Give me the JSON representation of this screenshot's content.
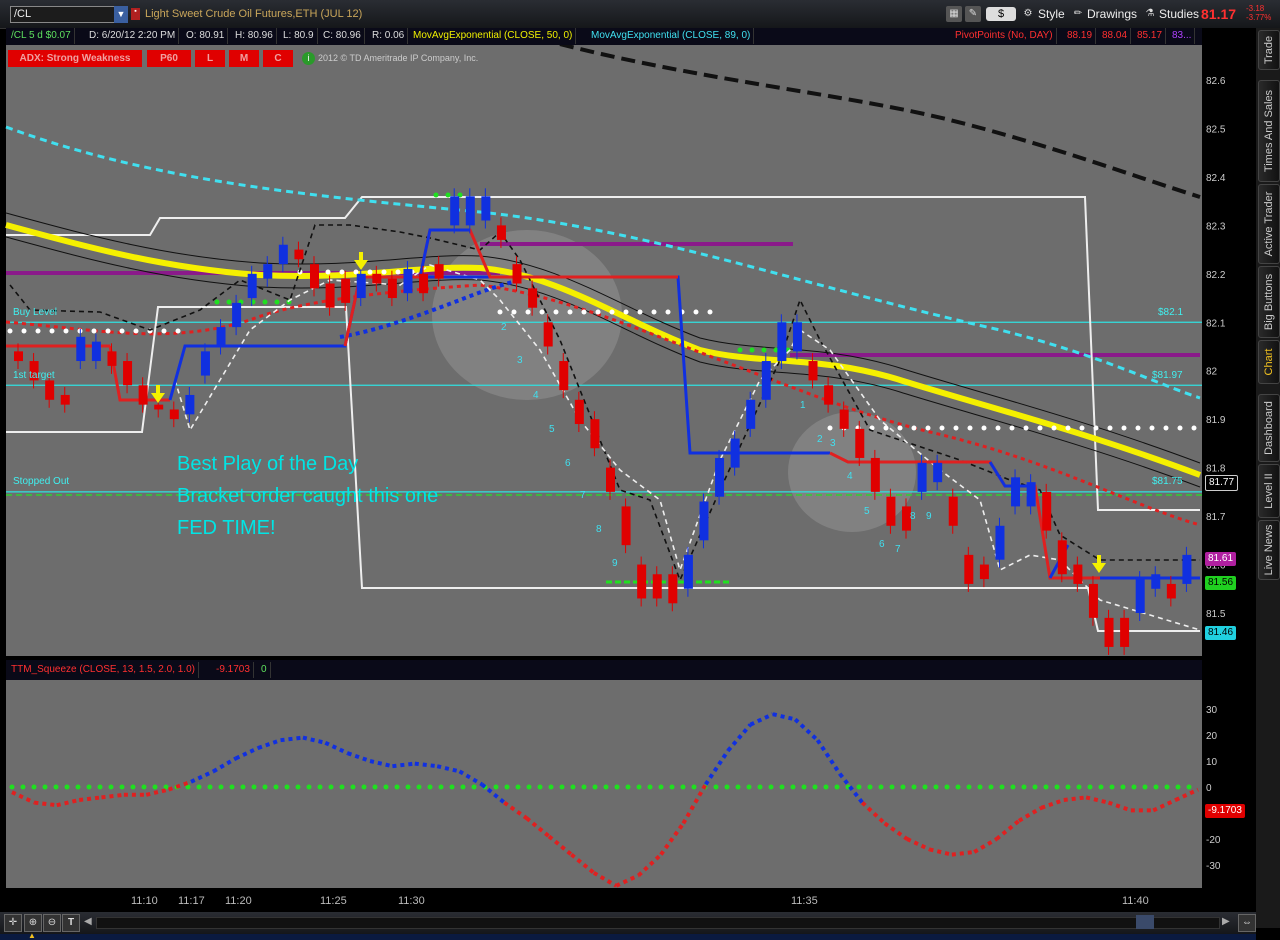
{
  "toolbar": {
    "symbol": "/CL",
    "title": "Light Sweet Crude Oil Futures,ETH (JUL 12)",
    "dollar_label": "$",
    "style_label": "Style",
    "drawings_label": "Drawings",
    "studies_label": "Studies",
    "last_price": "81.17",
    "net_change": "-3.18",
    "net_change_pct": "-3.77%"
  },
  "info_bar": {
    "symbol_cell": "/CL 5 d $0.07",
    "datetime": "D: 6/20/12 2:20 PM",
    "open": "O: 80.91",
    "high": "H: 80.96",
    "low": "L: 80.9",
    "close": "C: 80.96",
    "range": "R: 0.06",
    "ema50": "MovAvgExponential (CLOSE, 50, 0)",
    "ema89": "MovAvgExponential (CLOSE, 89, 0)",
    "pivots": "PivotPoints (No, DAY)",
    "pivot_values": [
      "88.19",
      "88.04",
      "85.17",
      "83..."
    ]
  },
  "adx": {
    "label": "ADX: Strong Weakness",
    "p60": "P60",
    "l": "L",
    "m": "M",
    "c": "C",
    "copyright": "2012 © TD Ameritrade IP Company, Inc."
  },
  "side_tabs": [
    "Trade",
    "Times And Sales",
    "Active Trader",
    "Big Buttons",
    "Chart",
    "Dashboard",
    "Level II",
    "Live News"
  ],
  "annotations": {
    "buy_level": "Buy Level",
    "first_target": "1st target",
    "stopped_out": "Stopped Out",
    "buy_price": "$82.1",
    "target_price": "$81.97",
    "stop_price": "$81.75",
    "play_line1": "Best Play of the Day",
    "play_line2": "Bracket order caught this one",
    "play_line3": "FED TIME!"
  },
  "price_tags": {
    "p1": "81.77",
    "p2": "81.61",
    "p3": "81.56",
    "p4": "81.46"
  },
  "lower": {
    "study": "TTM_Squeeze (CLOSE, 13, 1.5, 2.0, 1.0)",
    "value": "-9.1703",
    "zero": "0",
    "tag": "-9.1703"
  },
  "time_axis": [
    "11:10",
    "11:17",
    "11:20",
    "11:25",
    "11:30",
    "11:35",
    "11:40"
  ],
  "chart_data": [
    {
      "type": "candlestick",
      "title": "Light Sweet Crude Oil Futures,ETH (JUL 12)",
      "ylim": [
        81.4,
        82.65
      ],
      "yticks": [
        81.5,
        81.6,
        81.7,
        81.8,
        81.9,
        82,
        82.1,
        82.2,
        82.3,
        82.4,
        82.5,
        82.6
      ],
      "x_ticks": [
        "11:10",
        "11:17",
        "11:20",
        "11:25",
        "11:30",
        "11:35",
        "11:40"
      ],
      "levels": [
        {
          "name": "Buy Level",
          "value": 82.1
        },
        {
          "name": "1st target",
          "value": 81.97
        },
        {
          "name": "Stopped Out",
          "value": 81.75
        }
      ],
      "candles": [
        {
          "o": 82.04,
          "c": 82.02,
          "up": false
        },
        {
          "o": 82.02,
          "c": 81.98,
          "up": false
        },
        {
          "o": 81.98,
          "c": 81.94,
          "up": false
        },
        {
          "o": 81.95,
          "c": 81.93,
          "up": false
        },
        {
          "o": 82.02,
          "c": 82.07,
          "up": true
        },
        {
          "o": 82.02,
          "c": 82.06,
          "up": true
        },
        {
          "o": 82.04,
          "c": 82.01,
          "up": false
        },
        {
          "o": 82.02,
          "c": 81.97,
          "up": false
        },
        {
          "o": 81.97,
          "c": 81.93,
          "up": false
        },
        {
          "o": 81.93,
          "c": 81.92,
          "up": false
        },
        {
          "o": 81.92,
          "c": 81.9,
          "up": false
        },
        {
          "o": 81.91,
          "c": 81.95,
          "up": true
        },
        {
          "o": 81.99,
          "c": 82.04,
          "up": true
        },
        {
          "o": 82.05,
          "c": 82.09,
          "up": true
        },
        {
          "o": 82.09,
          "c": 82.14,
          "up": true
        },
        {
          "o": 82.15,
          "c": 82.2,
          "up": true
        },
        {
          "o": 82.19,
          "c": 82.22,
          "up": true
        },
        {
          "o": 82.22,
          "c": 82.26,
          "up": true
        },
        {
          "o": 82.25,
          "c": 82.23,
          "up": false
        },
        {
          "o": 82.22,
          "c": 82.17,
          "up": false
        },
        {
          "o": 82.18,
          "c": 82.13,
          "up": false
        },
        {
          "o": 82.19,
          "c": 82.14,
          "up": false
        },
        {
          "o": 82.15,
          "c": 82.2,
          "up": true
        },
        {
          "o": 82.2,
          "c": 82.18,
          "up": false
        },
        {
          "o": 82.19,
          "c": 82.15,
          "up": false
        },
        {
          "o": 82.16,
          "c": 82.21,
          "up": true
        },
        {
          "o": 82.2,
          "c": 82.16,
          "up": false
        },
        {
          "o": 82.22,
          "c": 82.19,
          "up": false
        },
        {
          "o": 82.3,
          "c": 82.36,
          "up": true
        },
        {
          "o": 82.3,
          "c": 82.36,
          "up": true
        },
        {
          "o": 82.31,
          "c": 82.36,
          "up": true
        },
        {
          "o": 82.3,
          "c": 82.27,
          "up": false
        },
        {
          "o": 82.22,
          "c": 82.18,
          "up": false
        },
        {
          "o": 82.17,
          "c": 82.13,
          "up": false
        },
        {
          "o": 82.1,
          "c": 82.05,
          "up": false
        },
        {
          "o": 82.02,
          "c": 81.96,
          "up": false
        },
        {
          "o": 81.94,
          "c": 81.89,
          "up": false
        },
        {
          "o": 81.9,
          "c": 81.84,
          "up": false
        },
        {
          "o": 81.8,
          "c": 81.75,
          "up": false
        },
        {
          "o": 81.72,
          "c": 81.64,
          "up": false
        },
        {
          "o": 81.6,
          "c": 81.53,
          "up": false
        },
        {
          "o": 81.58,
          "c": 81.53,
          "up": false
        },
        {
          "o": 81.58,
          "c": 81.52,
          "up": false
        },
        {
          "o": 81.55,
          "c": 81.62,
          "up": true
        },
        {
          "o": 81.65,
          "c": 81.73,
          "up": true
        },
        {
          "o": 81.74,
          "c": 81.82,
          "up": true
        },
        {
          "o": 81.8,
          "c": 81.86,
          "up": true
        },
        {
          "o": 81.88,
          "c": 81.94,
          "up": true
        },
        {
          "o": 81.94,
          "c": 82.02,
          "up": true
        },
        {
          "o": 82.02,
          "c": 82.1,
          "up": true
        },
        {
          "o": 82.04,
          "c": 82.1,
          "up": true
        },
        {
          "o": 82.02,
          "c": 81.98,
          "up": false
        },
        {
          "o": 81.97,
          "c": 81.93,
          "up": false
        },
        {
          "o": 81.92,
          "c": 81.88,
          "up": false
        },
        {
          "o": 81.88,
          "c": 81.82,
          "up": false
        },
        {
          "o": 81.82,
          "c": 81.75,
          "up": false
        },
        {
          "o": 81.74,
          "c": 81.68,
          "up": false
        },
        {
          "o": 81.72,
          "c": 81.67,
          "up": false
        },
        {
          "o": 81.75,
          "c": 81.81,
          "up": true
        },
        {
          "o": 81.77,
          "c": 81.81,
          "up": true
        },
        {
          "o": 81.74,
          "c": 81.68,
          "up": false
        },
        {
          "o": 81.62,
          "c": 81.56,
          "up": false
        },
        {
          "o": 81.6,
          "c": 81.57,
          "up": false
        },
        {
          "o": 81.61,
          "c": 81.68,
          "up": true
        },
        {
          "o": 81.72,
          "c": 81.78,
          "up": true
        },
        {
          "o": 81.72,
          "c": 81.77,
          "up": true
        },
        {
          "o": 81.75,
          "c": 81.67,
          "up": false
        },
        {
          "o": 81.65,
          "c": 81.58,
          "up": false
        },
        {
          "o": 81.6,
          "c": 81.56,
          "up": false
        },
        {
          "o": 81.56,
          "c": 81.49,
          "up": false
        },
        {
          "o": 81.49,
          "c": 81.43,
          "up": false
        },
        {
          "o": 81.49,
          "c": 81.43,
          "up": false
        },
        {
          "o": 81.5,
          "c": 81.57,
          "up": true
        },
        {
          "o": 81.55,
          "c": 81.58,
          "up": true
        },
        {
          "o": 81.53,
          "c": 81.56,
          "up": false
        },
        {
          "o": 81.56,
          "c": 81.62,
          "up": true
        }
      ]
    },
    {
      "type": "line",
      "title": "TTM_Squeeze (CLOSE, 13, 1.5, 2.0, 1.0)",
      "ylim": [
        -35,
        35
      ],
      "yticks": [
        -30,
        -20,
        -10,
        0,
        10,
        20,
        30
      ],
      "series": [
        {
          "values": [
            -2,
            -6,
            -7,
            -5,
            -4,
            -3,
            -3,
            -1,
            2,
            6,
            11,
            15,
            18,
            19,
            17,
            13,
            10,
            8,
            9,
            8,
            6,
            1,
            -6,
            -12,
            -19,
            -26,
            -33,
            -38,
            -34,
            -26,
            -14,
            1,
            14,
            24,
            28,
            26,
            18,
            5,
            -6,
            -14,
            -20,
            -24,
            -26,
            -25,
            -20,
            -13,
            -8,
            -5,
            -4,
            -6,
            -9,
            -9,
            -5,
            -1
          ]
        }
      ]
    }
  ]
}
